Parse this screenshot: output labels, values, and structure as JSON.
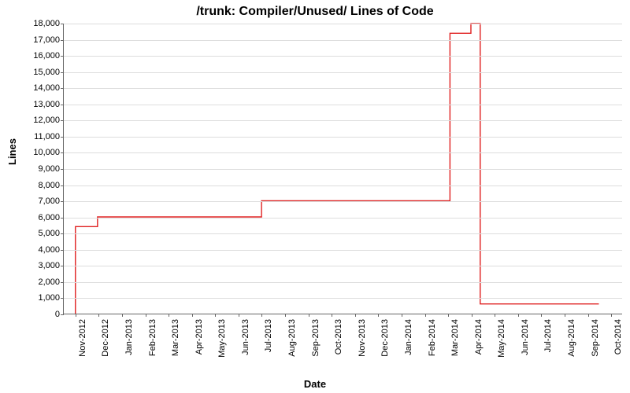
{
  "chart_data": {
    "type": "line",
    "title": "/trunk: Compiler/Unused/ Lines of Code",
    "xlabel": "Date",
    "ylabel": "Lines",
    "ylim": [
      0,
      18000
    ],
    "y_ticks": [
      0,
      1000,
      2000,
      3000,
      4000,
      5000,
      6000,
      7000,
      8000,
      9000,
      10000,
      11000,
      12000,
      13000,
      14000,
      15000,
      16000,
      17000,
      18000
    ],
    "y_tick_labels": [
      "0",
      "1,000",
      "2,000",
      "3,000",
      "4,000",
      "5,000",
      "6,000",
      "7,000",
      "8,000",
      "9,000",
      "10,000",
      "11,000",
      "12,000",
      "13,000",
      "14,000",
      "15,000",
      "16,000",
      "17,000",
      "18,000"
    ],
    "categories": [
      "Nov-2012",
      "Dec-2012",
      "Jan-2013",
      "Feb-2013",
      "Mar-2013",
      "Apr-2013",
      "May-2013",
      "Jun-2013",
      "Jul-2013",
      "Aug-2013",
      "Sep-2013",
      "Oct-2013",
      "Nov-2013",
      "Dec-2013",
      "Jan-2014",
      "Feb-2014",
      "Mar-2014",
      "Apr-2014",
      "May-2014",
      "Jun-2014",
      "Jul-2014",
      "Aug-2014",
      "Sep-2014",
      "Oct-2014"
    ],
    "series": [
      {
        "name": "Lines of Code",
        "color": "#e02020",
        "points": [
          {
            "xi": 0.0,
            "y": 0
          },
          {
            "xi": 0.0,
            "y": 5400
          },
          {
            "xi": 0.95,
            "y": 5400
          },
          {
            "xi": 0.95,
            "y": 6000
          },
          {
            "xi": 8.0,
            "y": 6000
          },
          {
            "xi": 8.0,
            "y": 7000
          },
          {
            "xi": 16.1,
            "y": 7000
          },
          {
            "xi": 16.1,
            "y": 17400
          },
          {
            "xi": 17.0,
            "y": 17400
          },
          {
            "xi": 17.0,
            "y": 18000
          },
          {
            "xi": 17.4,
            "y": 18000
          },
          {
            "xi": 17.4,
            "y": 600
          },
          {
            "xi": 22.5,
            "y": 600
          }
        ]
      }
    ]
  }
}
